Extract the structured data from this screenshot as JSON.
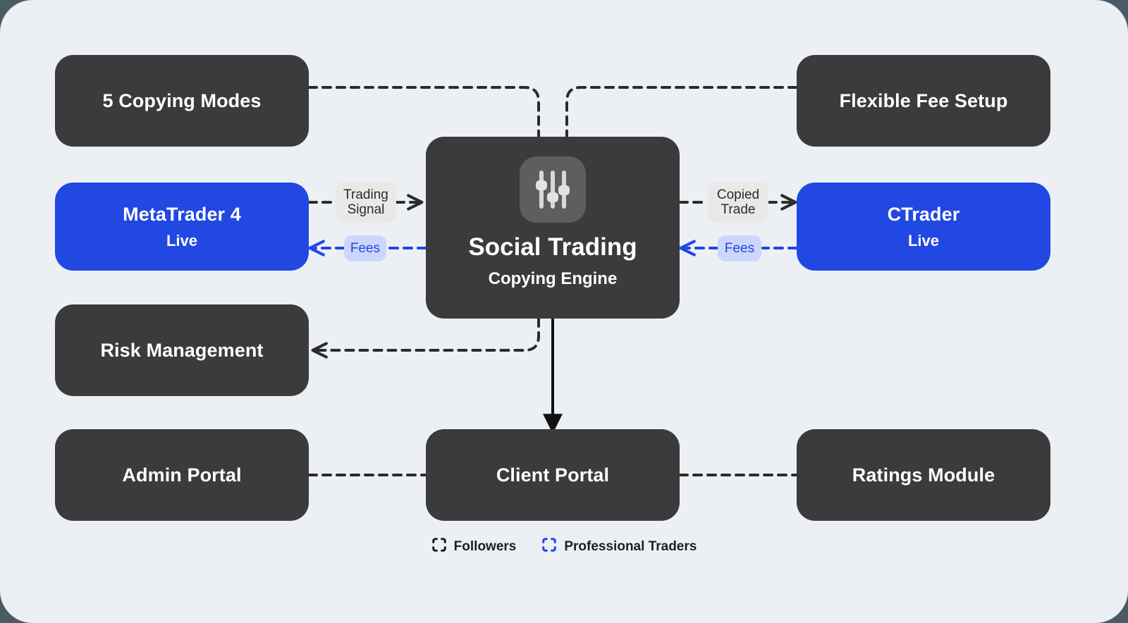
{
  "diagram": {
    "colors": {
      "page_background": "#4b5b65",
      "panel_background": "#ecf0f5",
      "dark_node": "#3b3b3b",
      "accent_blue": "#2148e3",
      "pill_gray": "#e9e9e7",
      "pill_lavender": "#ccd6fd"
    },
    "hub": {
      "icon": "sliders-icon",
      "title": "Social Trading",
      "subtitle": "Copying Engine"
    },
    "nodes": [
      {
        "id": "copying-modes",
        "title": "5 Copying Modes",
        "subtitle": "",
        "style": "dark"
      },
      {
        "id": "flexible-fee",
        "title": "Flexible Fee Setup",
        "subtitle": "",
        "style": "dark"
      },
      {
        "id": "metatrader-4",
        "title": "MetaTrader 4",
        "subtitle": "Live",
        "style": "blue"
      },
      {
        "id": "ctrader",
        "title": "CTrader",
        "subtitle": "Live",
        "style": "blue"
      },
      {
        "id": "risk-management",
        "title": "Risk Management",
        "subtitle": "",
        "style": "dark"
      },
      {
        "id": "admin-portal",
        "title": "Admin Portal",
        "subtitle": "",
        "style": "dark"
      },
      {
        "id": "client-portal",
        "title": "Client Portal",
        "subtitle": "",
        "style": "dark"
      },
      {
        "id": "ratings-module",
        "title": "Ratings Module",
        "subtitle": "",
        "style": "dark"
      }
    ],
    "edge_labels": [
      {
        "id": "trading-signal",
        "text": "Trading\nSignal",
        "style": "gray"
      },
      {
        "id": "fees-left",
        "text": "Fees",
        "style": "lavender"
      },
      {
        "id": "copied-trade",
        "text": "Copied\nTrade",
        "style": "gray"
      },
      {
        "id": "fees-right",
        "text": "Fees",
        "style": "lavender"
      }
    ],
    "legend": [
      {
        "id": "followers",
        "label": "Followers",
        "icon": "frame-corners-icon",
        "color": "#1e1e1e"
      },
      {
        "id": "professional-traders",
        "label": "Professional Traders",
        "icon": "frame-corners-icon",
        "color": "#2148e3"
      }
    ]
  }
}
